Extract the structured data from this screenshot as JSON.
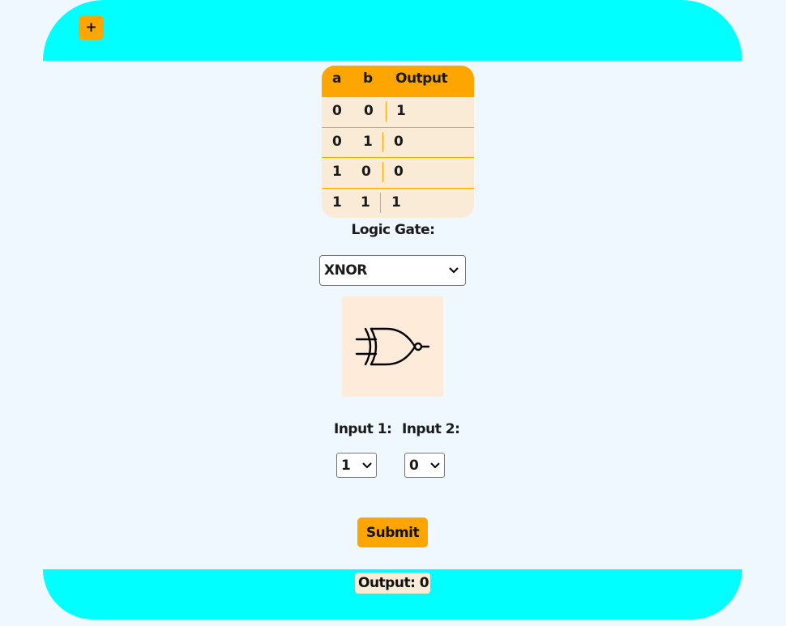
{
  "header": {
    "add_label": "+"
  },
  "truth_table": {
    "headers": [
      "a",
      "b",
      "Output"
    ],
    "rows": [
      [
        "0",
        "0",
        "1"
      ],
      [
        "0",
        "1",
        "0"
      ],
      [
        "1",
        "0",
        "0"
      ],
      [
        "1",
        "1",
        "1"
      ]
    ]
  },
  "gate": {
    "label": "Logic Gate:",
    "selected": "XNOR",
    "icon": "xnor-gate-icon"
  },
  "inputs": {
    "input1_label": "Input 1:",
    "input1_value": "1",
    "input2_label": "Input 2:",
    "input2_value": "0"
  },
  "submit_label": "Submit",
  "footer": {
    "output_text": "Output: 0"
  },
  "colors": {
    "header_footer": "#00ffff",
    "accent": "#ffa500",
    "panel": "#faebd7",
    "background": "#f0f8ff"
  }
}
